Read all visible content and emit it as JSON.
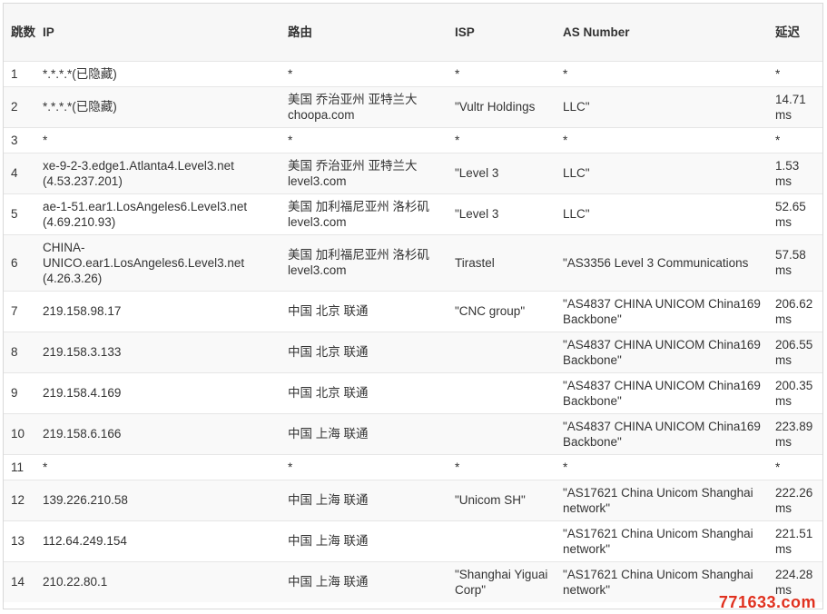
{
  "headers": {
    "hop": "跳数",
    "ip": "IP",
    "route": "路由",
    "isp": "ISP",
    "asn": "AS Number",
    "latency": "延迟"
  },
  "rows": [
    {
      "hop": "1",
      "ip": "*.*.*.*(已隐藏)",
      "route": "*",
      "isp": "*",
      "asn": "*",
      "latency": "*",
      "size": "short"
    },
    {
      "hop": "2",
      "ip": "*.*.*.*(已隐藏)",
      "route": "美国 乔治亚州 亚特兰大 choopa.com",
      "isp": "\"Vultr Holdings",
      "asn": "LLC\"",
      "latency": "14.71 ms",
      "size": "normal"
    },
    {
      "hop": "3",
      "ip": "*",
      "route": "*",
      "isp": "*",
      "asn": "*",
      "latency": "*",
      "size": "short"
    },
    {
      "hop": "4",
      "ip": "xe-9-2-3.edge1.Atlanta4.Level3.net (4.53.237.201)",
      "route": "美国 乔治亚州 亚特兰大 level3.com",
      "isp": "\"Level 3",
      "asn": "LLC\"",
      "latency": "1.53 ms",
      "size": "normal"
    },
    {
      "hop": "5",
      "ip": "ae-1-51.ear1.LosAngeles6.Level3.net (4.69.210.93)",
      "route": "美国 加利福尼亚州 洛杉矶 level3.com",
      "isp": "\"Level 3",
      "asn": "LLC\"",
      "latency": "52.65 ms",
      "size": "normal"
    },
    {
      "hop": "6",
      "ip": "CHINA-UNICO.ear1.LosAngeles6.Level3.net (4.26.3.26)",
      "route": "美国 加利福尼亚州 洛杉矶 level3.com",
      "isp": "Tirastel",
      "asn": "\"AS3356 Level 3 Communications",
      "latency": "57.58 ms",
      "size": "tall"
    },
    {
      "hop": "7",
      "ip": "219.158.98.17",
      "route": "中国 北京 联通",
      "isp": "\"CNC group\"",
      "asn": "\"AS4837 CHINA UNICOM China169 Backbone\"",
      "latency": "206.62 ms",
      "size": "normal"
    },
    {
      "hop": "8",
      "ip": "219.158.3.133",
      "route": "中国 北京 联通",
      "isp": "",
      "asn": "\"AS4837 CHINA UNICOM China169 Backbone\"",
      "latency": "206.55 ms",
      "size": "normal"
    },
    {
      "hop": "9",
      "ip": "219.158.4.169",
      "route": "中国 北京 联通",
      "isp": "",
      "asn": "\"AS4837 CHINA UNICOM China169 Backbone\"",
      "latency": "200.35 ms",
      "size": "normal"
    },
    {
      "hop": "10",
      "ip": "219.158.6.166",
      "route": "中国 上海 联通",
      "isp": "",
      "asn": "\"AS4837 CHINA UNICOM China169 Backbone\"",
      "latency": "223.89 ms",
      "size": "normal"
    },
    {
      "hop": "11",
      "ip": "*",
      "route": "*",
      "isp": "*",
      "asn": "*",
      "latency": "*",
      "size": "short"
    },
    {
      "hop": "12",
      "ip": "139.226.210.58",
      "route": "中国 上海 联通",
      "isp": "\"Unicom SH\"",
      "asn": "\"AS17621 China Unicom Shanghai network\"",
      "latency": "222.26 ms",
      "size": "normal"
    },
    {
      "hop": "13",
      "ip": "112.64.249.154",
      "route": "中国 上海 联通",
      "isp": "",
      "asn": "\"AS17621 China Unicom Shanghai network\"",
      "latency": "221.51 ms",
      "size": "normal"
    },
    {
      "hop": "14",
      "ip": "210.22.80.1",
      "route": "中国 上海 联通",
      "isp": "\"Shanghai Yiguai Corp\"",
      "asn": "\"AS17621 China Unicom Shanghai network\"",
      "latency": "224.28 ms",
      "size": "normal"
    }
  ],
  "watermark": "771633.com"
}
